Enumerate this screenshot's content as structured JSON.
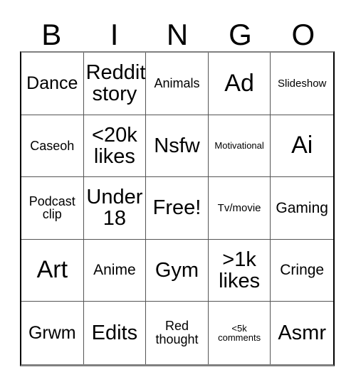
{
  "card": {
    "title": "BINGO",
    "header_letters": [
      "B",
      "I",
      "N",
      "G",
      "O"
    ],
    "colors": {
      "background": "#ffffff",
      "text": "#000000",
      "grid_line": "#555555",
      "outer_border": "#000000"
    },
    "rows": 5,
    "columns": 5,
    "cells": [
      {
        "text": "Dance",
        "size": "xl"
      },
      {
        "text": "Reddit\nstory",
        "size": "xxl"
      },
      {
        "text": "Animals",
        "size": "md"
      },
      {
        "text": "Ad",
        "size": "huge"
      },
      {
        "text": "Slideshow",
        "size": "sm"
      },
      {
        "text": "Caseoh",
        "size": "md"
      },
      {
        "text": "<20k\nlikes",
        "size": "xxl"
      },
      {
        "text": "Nsfw",
        "size": "xxl"
      },
      {
        "text": "Motivational",
        "size": "xs"
      },
      {
        "text": "Ai",
        "size": "huge"
      },
      {
        "text": "Podcast\nclip",
        "size": "md"
      },
      {
        "text": "Under\n18",
        "size": "xxl"
      },
      {
        "text": "Free!",
        "size": "xxl"
      },
      {
        "text": "Tv/movie",
        "size": "sm"
      },
      {
        "text": "Gaming",
        "size": "lg"
      },
      {
        "text": "Art",
        "size": "huge"
      },
      {
        "text": "Anime",
        "size": "lg"
      },
      {
        "text": "Gym",
        "size": "xxl"
      },
      {
        "text": ">1k\nlikes",
        "size": "xxl"
      },
      {
        "text": "Cringe",
        "size": "lg"
      },
      {
        "text": "Grwm",
        "size": "xl"
      },
      {
        "text": "Edits",
        "size": "xxl"
      },
      {
        "text": "Red\nthought",
        "size": "md"
      },
      {
        "text": "<5k\ncomments",
        "size": "xs"
      },
      {
        "text": "Asmr",
        "size": "xxl"
      }
    ]
  }
}
